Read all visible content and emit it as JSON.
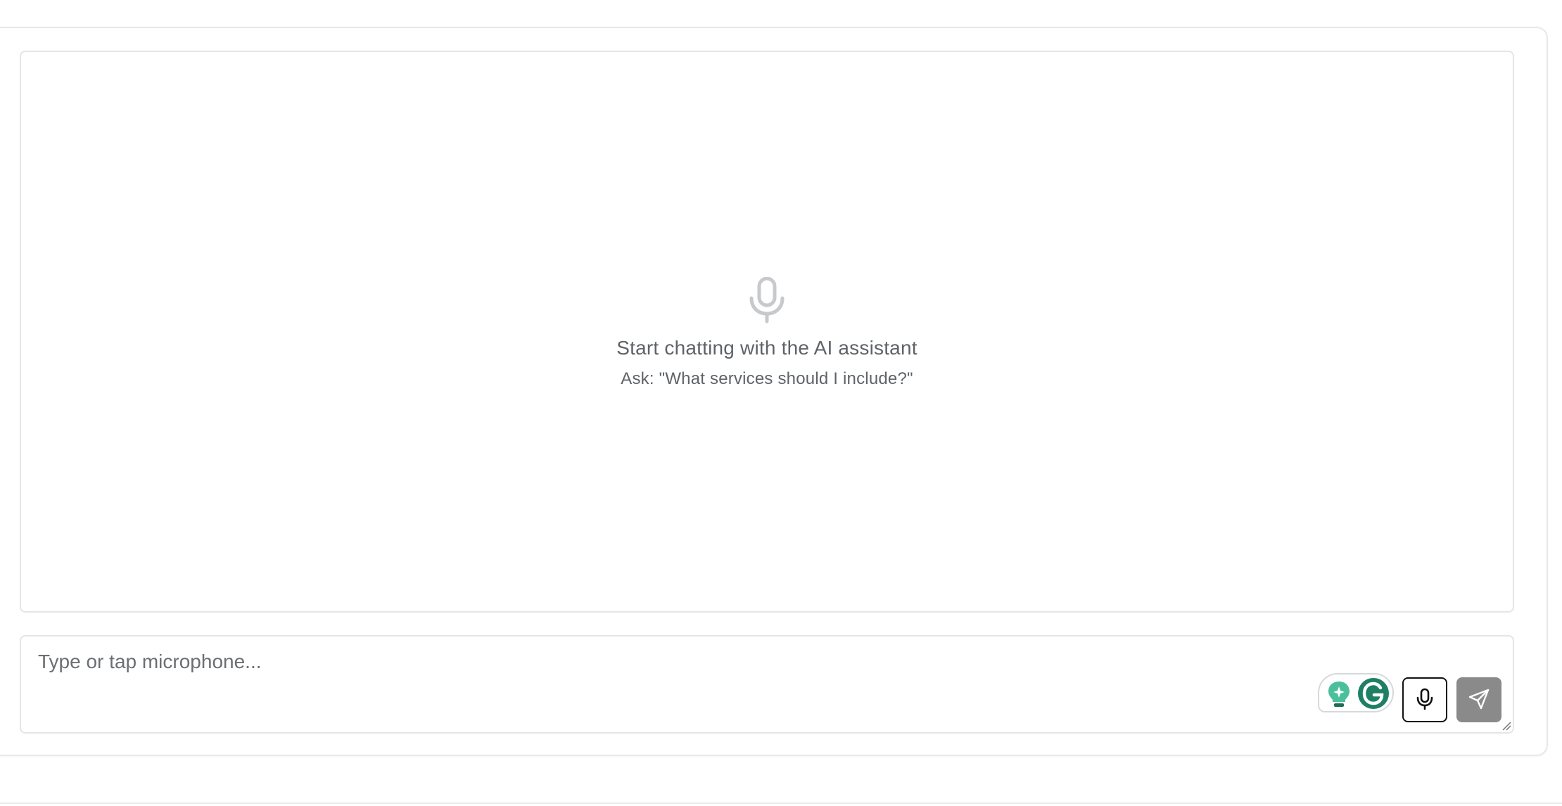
{
  "chat": {
    "empty_state": {
      "icon": "microphone-icon",
      "title": "Start chatting with the AI assistant",
      "hint": "Ask: \"What services should I include?\""
    },
    "composer": {
      "placeholder": "Type or tap microphone...",
      "value": ""
    },
    "actions": {
      "mic_icon": "microphone-icon",
      "send_icon": "send-icon"
    },
    "extensions": {
      "grammarly_icons": [
        "lightbulb-icon",
        "grammarly-icon"
      ]
    }
  },
  "colors": {
    "text_muted": "#5f6368",
    "border": "#e3e5e8",
    "send_button": "#8a8a8a",
    "grammarly_green": "#15825d"
  }
}
